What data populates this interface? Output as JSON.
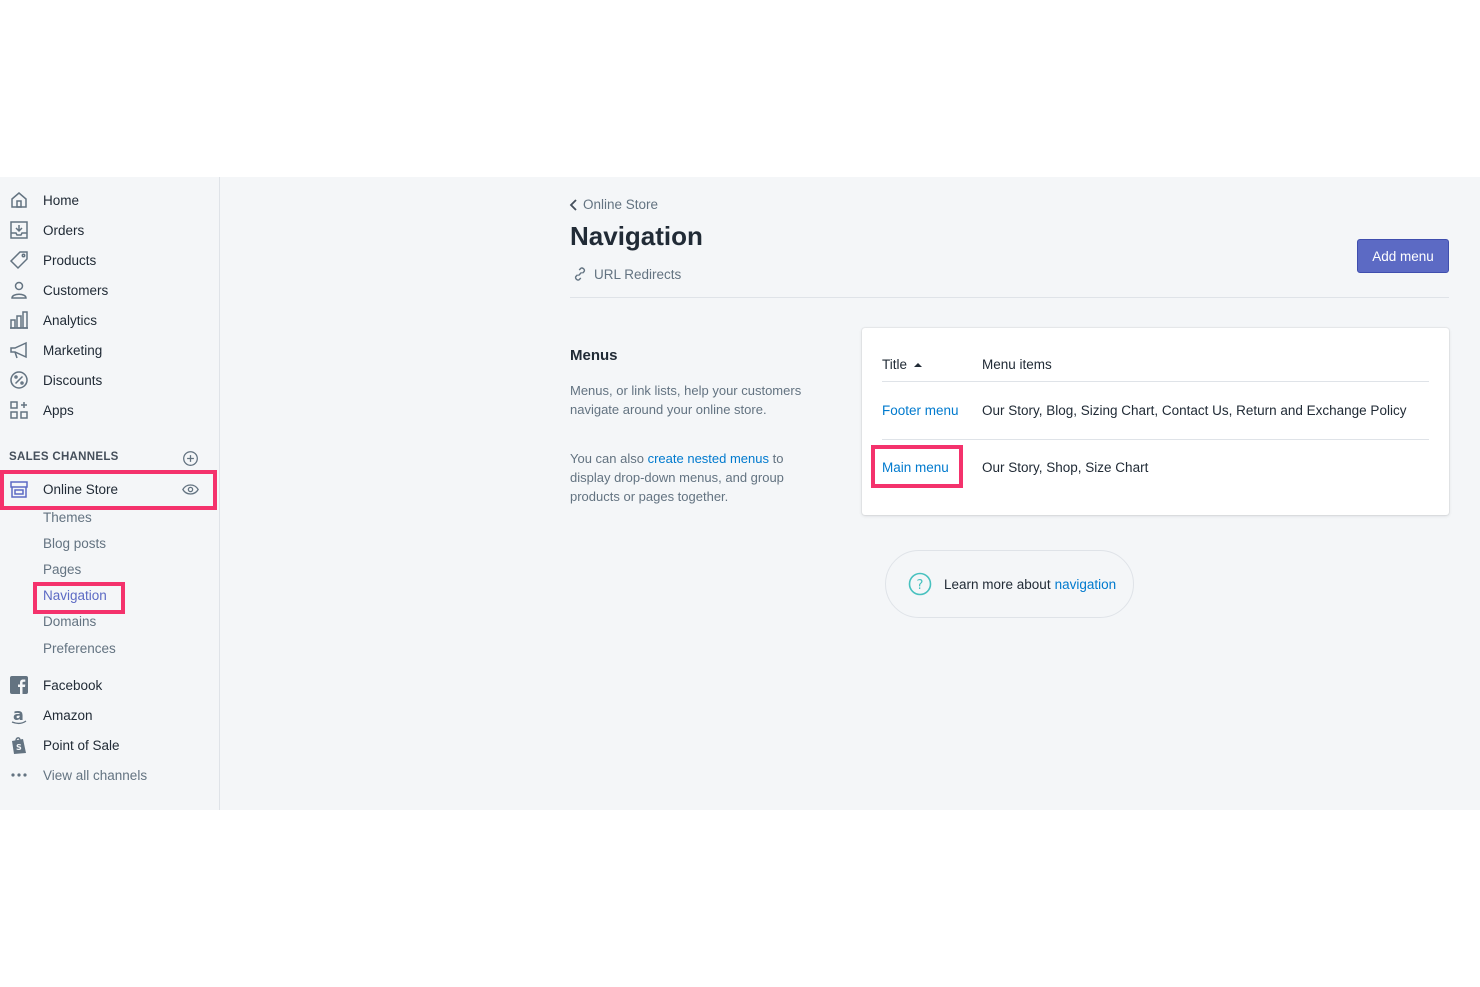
{
  "sidebar": {
    "items": [
      {
        "label": "Home",
        "icon": "home-icon"
      },
      {
        "label": "Orders",
        "icon": "orders-icon"
      },
      {
        "label": "Products",
        "icon": "tag-icon"
      },
      {
        "label": "Customers",
        "icon": "person-icon"
      },
      {
        "label": "Analytics",
        "icon": "bar-chart-icon"
      },
      {
        "label": "Marketing",
        "icon": "megaphone-icon"
      },
      {
        "label": "Discounts",
        "icon": "discount-icon"
      },
      {
        "label": "Apps",
        "icon": "apps-icon"
      }
    ],
    "sales_channels_heading": "SALES CHANNELS",
    "online_store": "Online Store",
    "online_store_sub": [
      "Themes",
      "Blog posts",
      "Pages",
      "Navigation",
      "Domains",
      "Preferences"
    ],
    "channels": [
      "Facebook",
      "Amazon",
      "Point of Sale"
    ],
    "view_all": "View all channels"
  },
  "header": {
    "breadcrumb": "Online Store",
    "title": "Navigation",
    "url_redirects": "URL Redirects",
    "add_menu": "Add menu"
  },
  "menus_section": {
    "heading": "Menus",
    "desc1": "Menus, or link lists, help your customers navigate around your online store.",
    "desc2_pre": "You can also ",
    "desc2_link": "create nested menus",
    "desc2_post": " to display drop-down menus, and group products or pages together."
  },
  "table": {
    "col_title": "Title",
    "col_items": "Menu items",
    "rows": [
      {
        "title": "Footer menu",
        "items": "Our Story, Blog, Sizing Chart, Contact Us, Return and Exchange Policy"
      },
      {
        "title": "Main menu",
        "items": "Our Story, Shop, Size Chart"
      }
    ]
  },
  "learn_more": {
    "text": "Learn more about",
    "link": "navigation"
  },
  "colors": {
    "accent": "#5c6ac4",
    "link": "#007ace",
    "highlight": "#f4326c",
    "active_sub": "#5c6ac4"
  }
}
